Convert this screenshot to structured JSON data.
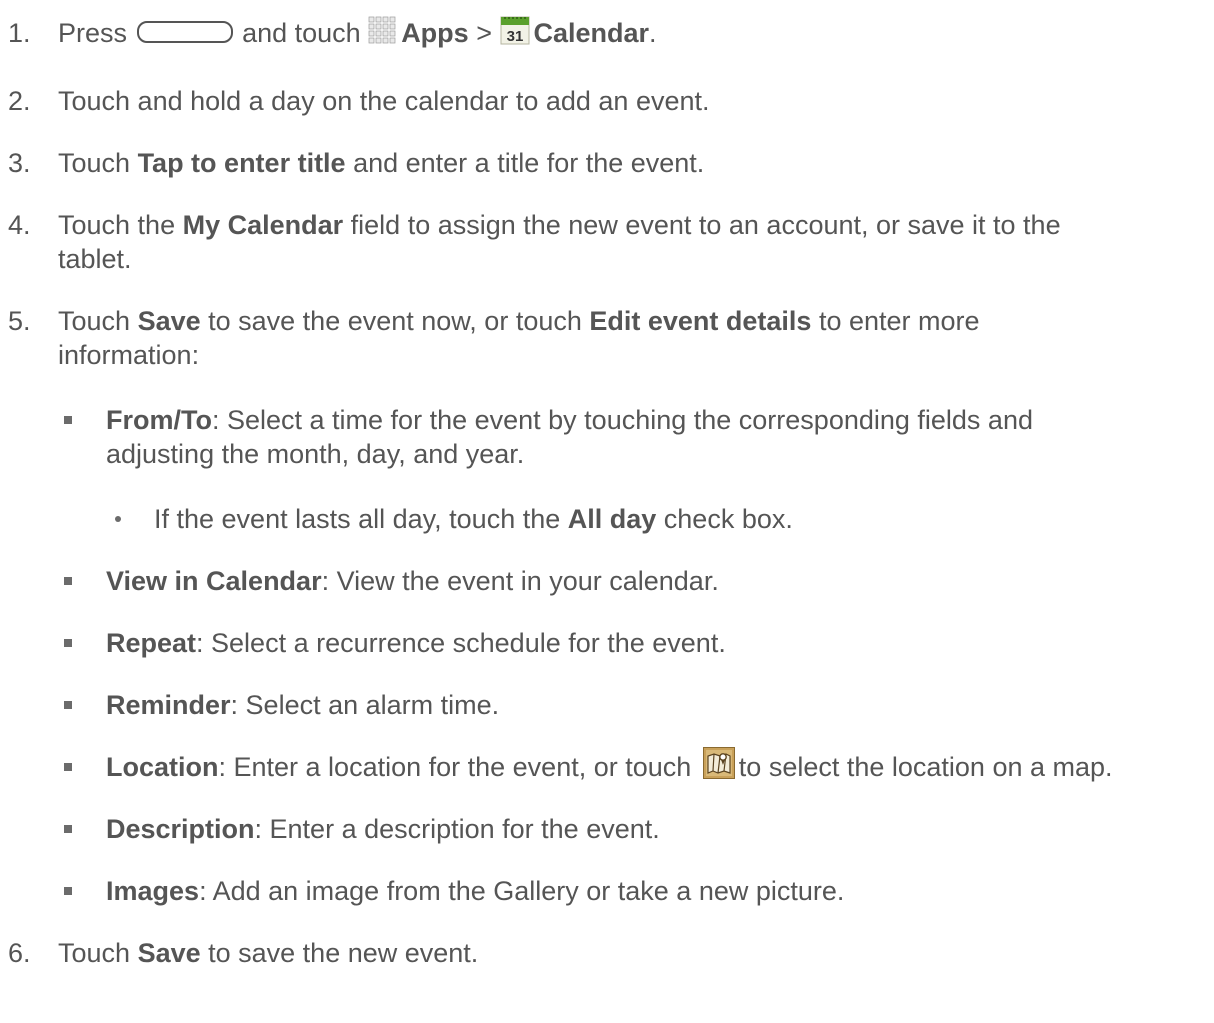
{
  "icons": {
    "home_key": "home-key-icon",
    "apps": "apps-grid-icon",
    "calendar": "calendar-31-icon",
    "map": "map-location-icon"
  },
  "calendar_icon": {
    "day": "31",
    "top_color": "#5aa02c",
    "face_color": "#f2f2e6"
  },
  "colors": {
    "text": "#555555",
    "bullet": "#6b6b6b"
  },
  "step1": {
    "num": "1.",
    "t1": "Press",
    "t2": "and touch",
    "apps": "Apps",
    "sep": ">",
    "calendar": "Calendar",
    "end": "."
  },
  "step2": {
    "num": "2.",
    "text": "Touch and hold a day on the calendar to add an event."
  },
  "step3": {
    "num": "3.",
    "t1": "Touch ",
    "b1": "Tap to enter title",
    "t2": " and enter a title for the event."
  },
  "step4": {
    "num": "4.",
    "t1": "Touch the ",
    "b1": "My Calendar",
    "t2": " field to assign the new event to an account, or save it to the",
    "line2": "tablet."
  },
  "step5": {
    "num": "5.",
    "t1": "Touch ",
    "b1": "Save",
    "t2": " to save the event now, or touch ",
    "b2": "Edit event details",
    "t3": " to enter more",
    "line2": "information:"
  },
  "bullets": {
    "from_to": {
      "b": "From/To",
      "t": ": Select a time for the event by touching the corresponding fields and",
      "line2": "adjusting the month, day, and year."
    },
    "all_day": {
      "t1": "If the event lasts all day, touch the ",
      "b": "All day",
      "t2": " check box."
    },
    "view": {
      "b": "View in Calendar",
      "t": ": View the event in your calendar."
    },
    "repeat": {
      "b": "Repeat",
      "t": ": Select a recurrence schedule for the event."
    },
    "reminder": {
      "b": "Reminder",
      "t": ": Select an alarm time."
    },
    "location": {
      "b": "Location",
      "t1": ": Enter a location for the event, or touch",
      "t2": "to select the location on a map."
    },
    "description": {
      "b": "Description",
      "t": ": Enter a description for the event."
    },
    "images": {
      "b": "Images",
      "t": ": Add an image from the Gallery or take a new picture."
    }
  },
  "step6": {
    "num": "6.",
    "t1": "Touch ",
    "b1": "Save",
    "t2": " to save the new event."
  }
}
